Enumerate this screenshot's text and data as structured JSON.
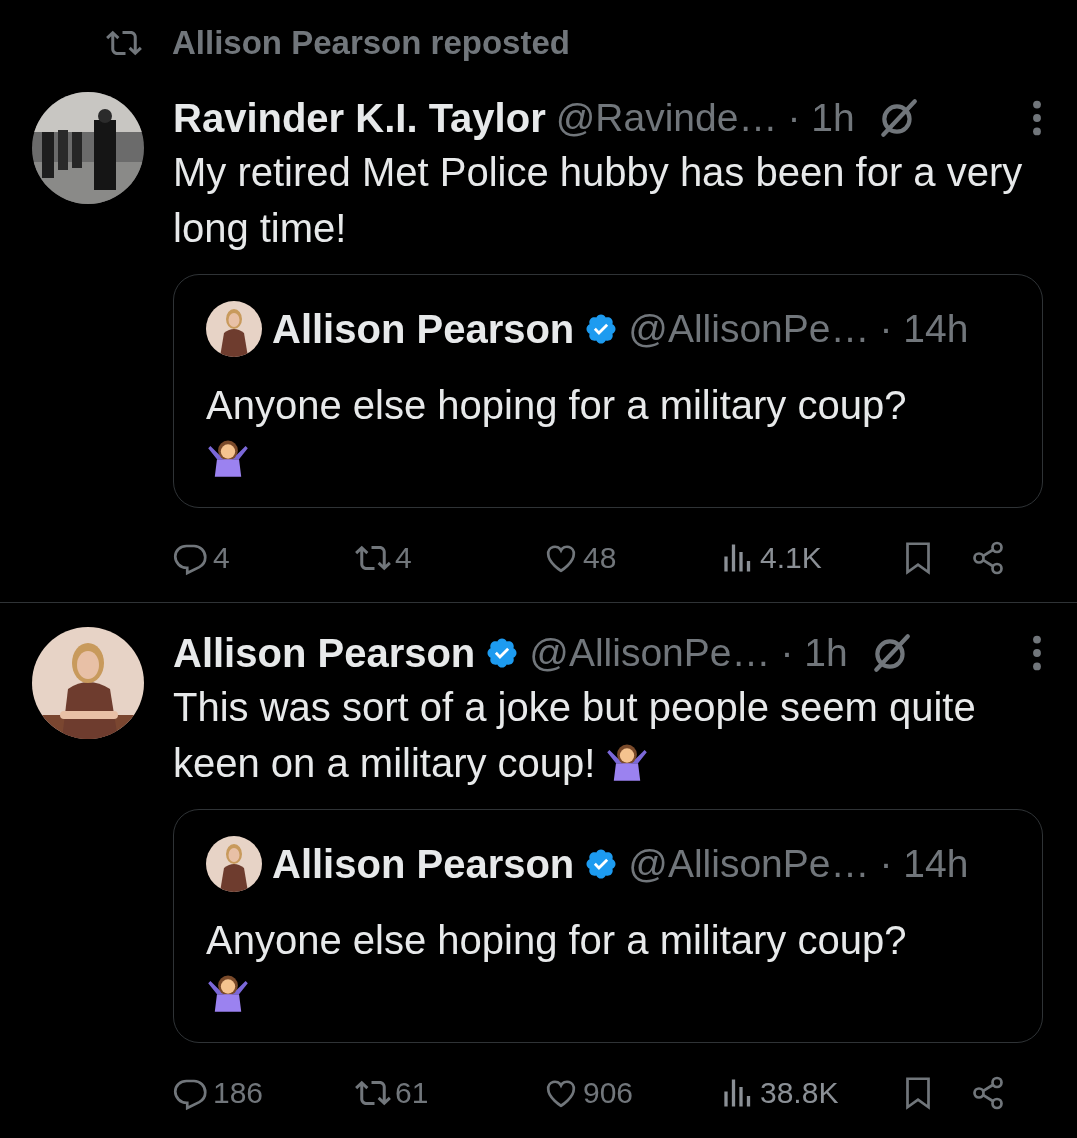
{
  "repost_banner": {
    "label": "Allison Pearson reposted"
  },
  "posts": [
    {
      "name": "Ravinder K.I. Taylor",
      "verified": false,
      "handle": "@Ravinde…",
      "time": "· 1h",
      "text": "My retired Met Police hubby has been for a very long time!",
      "text_emoji": false,
      "quote": {
        "name": "Allison Pearson",
        "verified": true,
        "handle": "@AllisonPe…",
        "time": "· 14h",
        "text": "Anyone else hoping for a military coup?",
        "emoji": true
      },
      "actions": {
        "replies": "4",
        "reposts": "4",
        "likes": "48",
        "views": "4.1K"
      }
    },
    {
      "name": "Allison Pearson",
      "verified": true,
      "handle": "@AllisonPe…",
      "time": "· 1h",
      "text": "This was sort of a joke but people seem quite keen on a military coup!",
      "text_emoji": true,
      "quote": {
        "name": "Allison Pearson",
        "verified": true,
        "handle": "@AllisonPe…",
        "time": "· 14h",
        "text": "Anyone else hoping for a military coup?",
        "emoji": true
      },
      "actions": {
        "replies": "186",
        "reposts": "61",
        "likes": "906",
        "views": "38.8K"
      }
    }
  ]
}
